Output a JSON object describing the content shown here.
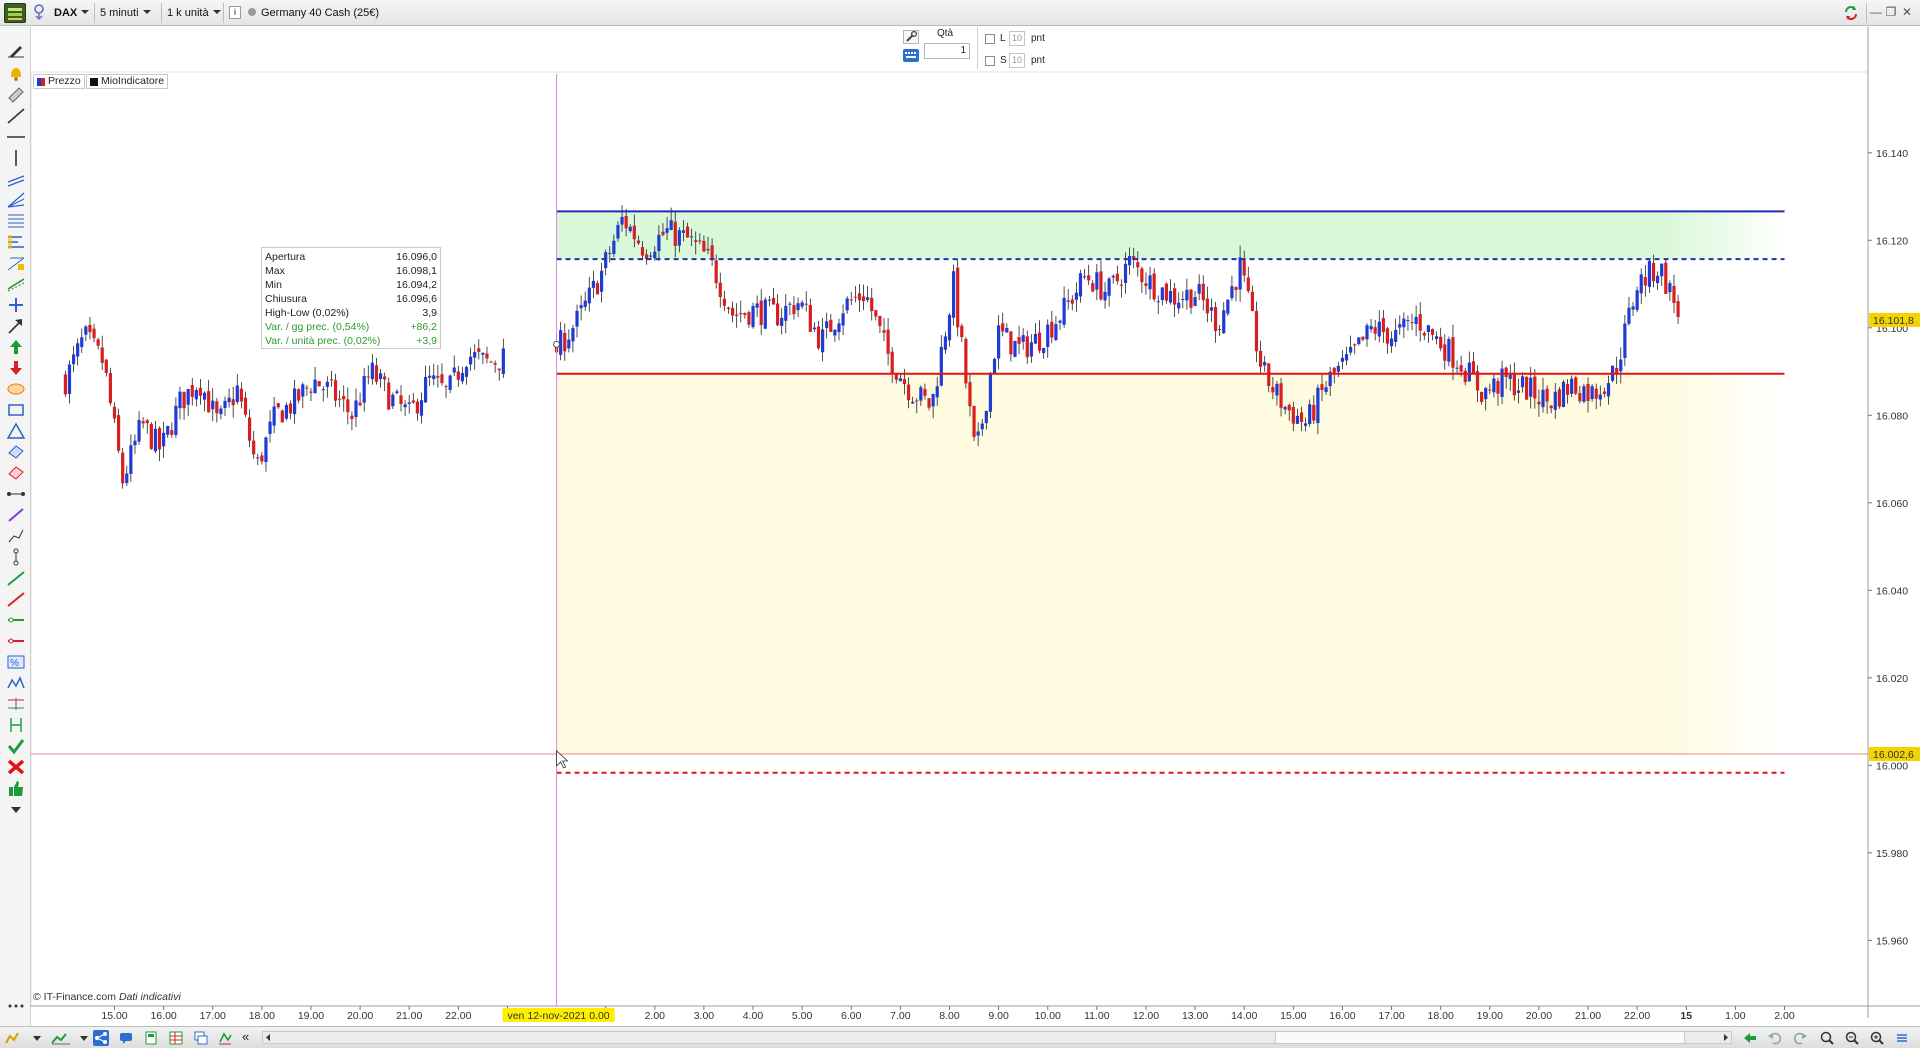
{
  "toolbar": {
    "symbol": "DAX",
    "timeframe": "5 minuti",
    "units": "1 k unità",
    "instrument": "Germany 40 Cash (25€)",
    "info_icon": "i"
  },
  "order_panel": {
    "qty_label": "Qtà",
    "qty_value": "1",
    "long_label": "L",
    "short_label": "S",
    "long_pts": "10",
    "short_pts": "10",
    "pts_unit": "pnt"
  },
  "legend": {
    "price": "Prezzo",
    "indicator": "MioIndicatore"
  },
  "infobox": {
    "rows": [
      {
        "label": "Apertura",
        "value": "16.096,0"
      },
      {
        "label": "Max",
        "value": "16.098,1"
      },
      {
        "label": "Min",
        "value": "16.094,2"
      },
      {
        "label": "Chiusura",
        "value": "16.096,6"
      },
      {
        "label": "High-Low (0,02%)",
        "value": "3,9"
      },
      {
        "label": "Var. / gg prec. (0,54%)",
        "value": "+86,2"
      },
      {
        "label": "Var. / unità prec. (0,02%)",
        "value": "+3,9"
      }
    ]
  },
  "footer": {
    "copyright": "© IT-Finance.com",
    "disclaimer": "Dati indicativi"
  },
  "crosshair": {
    "date_label": "ven 12-nov-2021 0.00",
    "price_label": "16.002,6"
  },
  "last_price_label": "16.101,8",
  "colors": {
    "bull": "#1f3bd6",
    "bear": "#d81f1f",
    "resistance": "#1f2fb0",
    "support": "#e01515",
    "upper_zone": "#d9f7d9",
    "lower_zone": "#fffbe0",
    "crosshair_v": "#d58ad5",
    "crosshair_h": "#e88a8a",
    "date_label_bg": "#ffee00"
  },
  "chart_data": {
    "type": "candlestick",
    "timeframe": "5 minuti",
    "ylim": [
      15.945,
      16.158
    ],
    "y_ticks": [
      "16.140",
      "16.120",
      "16.100",
      "16.080",
      "16.060",
      "16.040",
      "16.020",
      "16.000",
      "15.980",
      "15.960"
    ],
    "y_tick_values": [
      16.14,
      16.12,
      16.1,
      16.08,
      16.06,
      16.04,
      16.02,
      16.0,
      15.98,
      15.96
    ],
    "x_ticks": [
      "15.00",
      "16.00",
      "17.00",
      "18.00",
      "19.00",
      "20.00",
      "21.00",
      "22.00",
      "2",
      "0",
      "2.00",
      "3.00",
      "4.00",
      "5.00",
      "6.00",
      "7.00",
      "8.00",
      "9.00",
      "10.00",
      "11.00",
      "12.00",
      "13.00",
      "14.00",
      "15.00",
      "16.00",
      "17.00",
      "18.00",
      "19.00",
      "20.00",
      "21.00",
      "22.00",
      "15",
      "1.00",
      "2.00"
    ],
    "x_tick_hours": [
      15,
      16,
      17,
      18,
      19,
      20,
      21,
      22,
      23,
      25,
      26,
      27,
      28,
      29,
      30,
      31,
      32,
      33,
      34,
      35,
      36,
      37,
      38,
      39,
      40,
      41,
      42,
      43,
      44,
      45,
      46,
      47,
      48,
      49
    ],
    "x_bold_ticks": [
      "15"
    ],
    "session_segments": [
      {
        "start_hour": 14.0,
        "end_hour": 22.95,
        "levels": [
          16.088,
          16.098,
          16.092,
          16.065,
          16.078,
          16.072,
          16.083,
          16.088,
          16.078,
          16.086,
          16.068,
          16.08,
          16.083,
          16.088,
          16.085,
          16.08,
          16.09,
          16.084,
          16.08,
          16.088,
          16.085,
          16.094,
          16.092,
          16.093
        ]
      },
      {
        "start_hour": 24.0,
        "end_hour": 46.9,
        "levels": [
          16.095,
          16.102,
          16.112,
          16.125,
          16.118,
          16.122,
          16.12,
          16.115,
          16.103,
          16.104,
          16.103,
          16.106,
          16.097,
          16.105,
          16.108,
          16.094,
          16.086,
          16.082,
          16.11,
          16.07,
          16.099,
          16.095,
          16.098,
          16.104,
          16.112,
          16.108,
          16.115,
          16.11,
          16.107,
          16.108,
          16.101,
          16.114,
          16.09,
          16.082,
          16.078,
          16.088,
          16.093,
          16.1,
          16.098,
          16.102,
          16.097,
          16.092,
          16.085,
          16.088,
          16.086,
          16.083,
          16.087,
          16.085,
          16.09,
          16.11,
          16.114,
          16.102
        ]
      }
    ],
    "levels": {
      "resistance_solid": 16.1266,
      "resistance_dashed": 16.1157,
      "support_solid": 16.0895,
      "support_dashed": 15.9983
    },
    "zones": [
      {
        "name": "upper",
        "from": 16.1157,
        "to": 16.1266,
        "start_hour": 24.0,
        "end_hour": 49.0
      },
      {
        "name": "lower",
        "from": 16.0026,
        "to": 16.0895,
        "start_hour": 24.0,
        "end_hour": 49.0
      }
    ],
    "crosshair_hour": 24.0,
    "crosshair_price": 16.0026,
    "last_price": 16.1018,
    "legend": [
      "Prezzo",
      "MioIndicatore"
    ]
  }
}
